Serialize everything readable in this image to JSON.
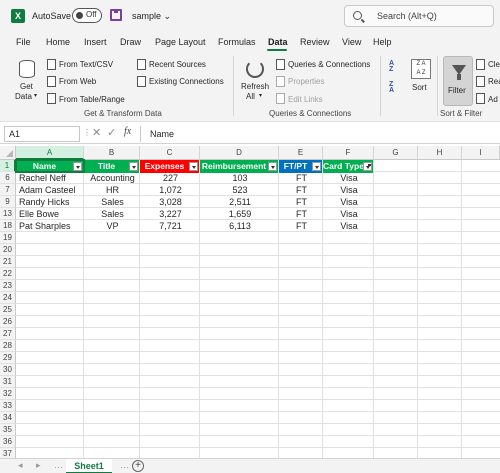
{
  "titlebar": {
    "autosave_label": "AutoSave",
    "autosave_state": "Off",
    "filename": "sample",
    "filename_chevron": "⌄",
    "search_placeholder": "Search (Alt+Q)"
  },
  "menu": [
    "File",
    "Home",
    "Insert",
    "Draw",
    "Page Layout",
    "Formulas",
    "Data",
    "Review",
    "View",
    "Help"
  ],
  "menu_active": "Data",
  "ribbon": {
    "get_data": "Get",
    "get_data_2": "Data",
    "from_text_csv": "From Text/CSV",
    "from_web": "From Web",
    "from_table_range": "From Table/Range",
    "recent_sources": "Recent Sources",
    "existing_connections": "Existing Connections",
    "group_get_transform": "Get & Transform Data",
    "refresh_all": "Refresh",
    "refresh_all_2": "All",
    "queries_connections": "Queries & Connections",
    "properties": "Properties",
    "edit_links": "Edit Links",
    "group_queries": "Queries & Connections",
    "sort": "Sort",
    "filter": "Filter",
    "clear": "Cle",
    "reapply": "Rea",
    "advanced": "Ad",
    "group_sort_filter": "Sort & Filter"
  },
  "formula_bar": {
    "name_box": "A1",
    "dots": "⋮",
    "cancel": "✕",
    "enter": "✓",
    "fx": "fx",
    "value": "Name"
  },
  "columns": [
    "A",
    "B",
    "C",
    "D",
    "E",
    "F",
    "G",
    "H",
    "I"
  ],
  "rows": [
    "1",
    "6",
    "7",
    "9",
    "13",
    "18",
    "19",
    "20",
    "21",
    "22",
    "23",
    "24",
    "25",
    "26",
    "27",
    "28",
    "29",
    "30",
    "31",
    "32",
    "33",
    "34",
    "35",
    "36",
    "37"
  ],
  "table": {
    "headers": [
      "Name",
      "Title",
      "Expenses",
      "Reimbursement",
      "FT/PT",
      "Card Type"
    ],
    "header_colors": [
      "#00b050",
      "#00b050",
      "#ff0000",
      "#00b050",
      "#0070c0",
      "#00b050"
    ],
    "rows": [
      [
        "Rachel Neff",
        "Accounting",
        "227",
        "103",
        "FT",
        "Visa"
      ],
      [
        "Adam Casteel",
        "HR",
        "1,072",
        "523",
        "FT",
        "Visa"
      ],
      [
        "Randy Hicks",
        "Sales",
        "3,028",
        "2,511",
        "FT",
        "Visa"
      ],
      [
        "Elle Bowe",
        "Sales",
        "3,227",
        "1,659",
        "FT",
        "Visa"
      ],
      [
        "Pat Sharples",
        "VP",
        "7,721",
        "6,113",
        "FT",
        "Visa"
      ]
    ]
  },
  "sheet_tabs": {
    "nav_prev": "◂",
    "nav_next": "▸",
    "more": "…",
    "active": "Sheet1",
    "add": "+"
  },
  "colors": {
    "excel_green": "#107c41",
    "selection_green": "#107c41"
  }
}
